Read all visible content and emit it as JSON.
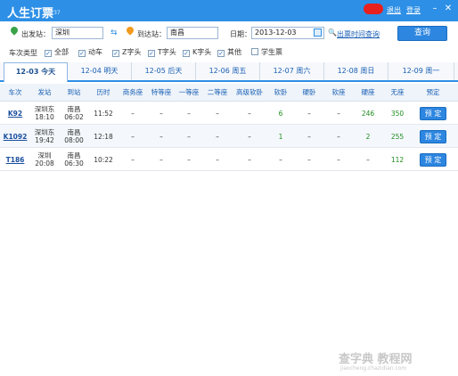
{
  "titlebar": {
    "title": "人生订票",
    "version": "V37",
    "logout": "退出",
    "login": "登录",
    "minimize_icon": "minimize-icon",
    "maximize_icon": "maximize-icon",
    "close_icon": "close-icon"
  },
  "search": {
    "from_label": "出发站：",
    "from_value": "深圳",
    "to_label": "到达站：",
    "to_value": "南昌",
    "date_label": "日期：",
    "date_value": "2013-12-03",
    "query_link": "出票时间查询",
    "query_button": "查询"
  },
  "filter": {
    "label": "车次类型",
    "options": [
      {
        "label": "全部",
        "checked": true
      },
      {
        "label": "动车",
        "checked": true
      },
      {
        "label": "Z字头",
        "checked": true
      },
      {
        "label": "T字头",
        "checked": true
      },
      {
        "label": "K字头",
        "checked": true
      },
      {
        "label": "其他",
        "checked": true
      },
      {
        "label": "学生票",
        "checked": false
      }
    ]
  },
  "tabs": [
    {
      "label": "12-03  今天",
      "active": true
    },
    {
      "label": "12-04  明天",
      "active": false
    },
    {
      "label": "12-05  后天",
      "active": false
    },
    {
      "label": "12-06  周五",
      "active": false
    },
    {
      "label": "12-07  周六",
      "active": false
    },
    {
      "label": "12-08  周日",
      "active": false
    },
    {
      "label": "12-09  周一",
      "active": false
    }
  ],
  "table": {
    "headers": [
      "车次",
      "发站",
      "到站",
      "历时",
      "商务座",
      "特等座",
      "一等座",
      "二等座",
      "高级软卧",
      "软卧",
      "硬卧",
      "软座",
      "硬座",
      "无座",
      "预定"
    ],
    "rows": [
      {
        "train": "K92",
        "from": "深圳东",
        "from_time": "18:10",
        "to": "南昌",
        "to_time": "06:02",
        "duration": "11:52",
        "shangwu": "–",
        "tedeng": "–",
        "yideng": "–",
        "erdeng": "–",
        "gaoji": "–",
        "ruanwo": "6",
        "yingwo": "–",
        "ruanzuo": "–",
        "yingzuo": "246",
        "wuzuo": "350",
        "book": "预 定"
      },
      {
        "train": "K1092",
        "from": "深圳东",
        "from_time": "19:42",
        "to": "南昌",
        "to_time": "08:00",
        "duration": "12:18",
        "shangwu": "–",
        "tedeng": "–",
        "yideng": "–",
        "erdeng": "–",
        "gaoji": "–",
        "ruanwo": "1",
        "yingwo": "–",
        "ruanzuo": "–",
        "yingzuo": "2",
        "wuzuo": "255",
        "book": "预 定"
      },
      {
        "train": "T186",
        "from": "深圳",
        "from_time": "20:08",
        "to": "南昌",
        "to_time": "06:30",
        "duration": "10:22",
        "shangwu": "–",
        "tedeng": "–",
        "yideng": "–",
        "erdeng": "–",
        "gaoji": "–",
        "ruanwo": "–",
        "yingwo": "–",
        "ruanzuo": "–",
        "yingzuo": "–",
        "wuzuo": "112",
        "book": "预 定"
      }
    ]
  },
  "watermark": {
    "main": "查字典 教程网",
    "sub": "jiaocheng.chazidian.com"
  },
  "colors": {
    "accent": "#2d8fe6",
    "button": "#2d86e0",
    "link": "#1a5fb4",
    "count_green": "#1f8c1f"
  }
}
